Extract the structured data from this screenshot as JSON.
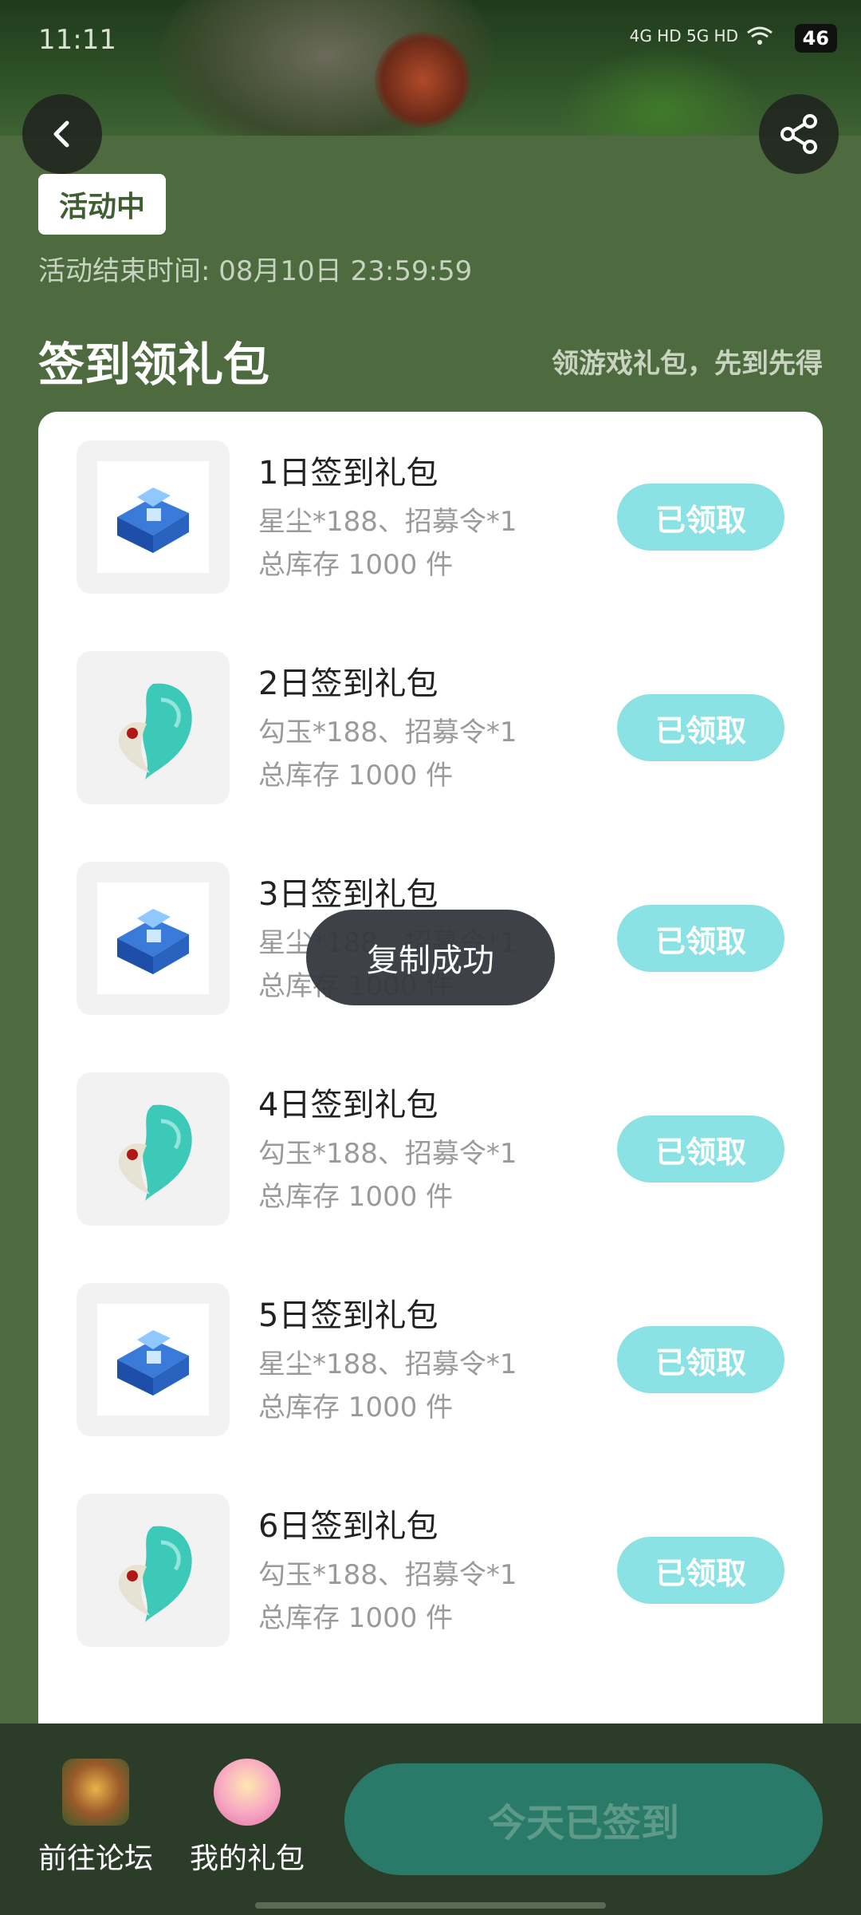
{
  "status_bar": {
    "time": "11:11",
    "network": "4G HD 5G HD",
    "battery": "46"
  },
  "header": {
    "status_pill": "活动中",
    "end_time": "活动结束时间: 08月10日 23:59:59"
  },
  "section": {
    "title": "签到领礼包",
    "subtitle": "领游戏礼包，先到先得"
  },
  "gifts": [
    {
      "name": "1日签到礼包",
      "desc": "星尘*188、招募令*1",
      "stock": "总库存 1000 件",
      "button": "已领取",
      "icon": "blue-chest-icon"
    },
    {
      "name": "2日签到礼包",
      "desc": "勾玉*188、招募令*1",
      "stock": "总库存 1000 件",
      "button": "已领取",
      "icon": "jade-magatama-icon"
    },
    {
      "name": "3日签到礼包",
      "desc": "星尘*188、招募令*1",
      "stock": "总库存 1000 件",
      "button": "已领取",
      "icon": "blue-chest-icon"
    },
    {
      "name": "4日签到礼包",
      "desc": "勾玉*188、招募令*1",
      "stock": "总库存 1000 件",
      "button": "已领取",
      "icon": "jade-magatama-icon"
    },
    {
      "name": "5日签到礼包",
      "desc": "星尘*188、招募令*1",
      "stock": "总库存 1000 件",
      "button": "已领取",
      "icon": "blue-chest-icon"
    },
    {
      "name": "6日签到礼包",
      "desc": "勾玉*188、招募令*1",
      "stock": "总库存 1000 件",
      "button": "已领取",
      "icon": "jade-magatama-icon"
    }
  ],
  "toast": "复制成功",
  "bottom_bar": {
    "forum_label": "前往论坛",
    "gifts_label": "我的礼包",
    "signed_label": "今天已签到"
  },
  "colors": {
    "page_bg": "#4d6b3f",
    "claimed_button": "#8be2e4",
    "signed_button": "#2a7a6a"
  }
}
